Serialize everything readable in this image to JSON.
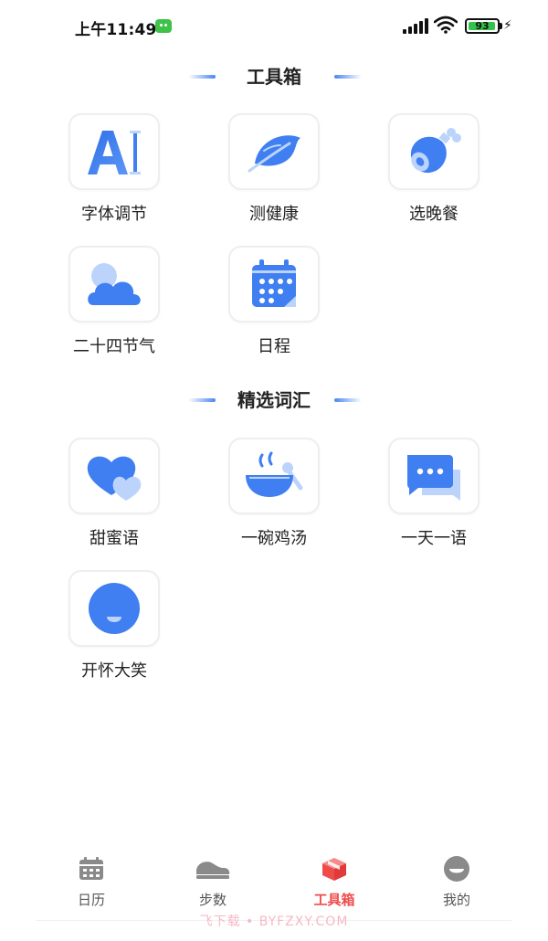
{
  "status_bar": {
    "time": "上午11:49",
    "battery": "93"
  },
  "sections": {
    "tools": {
      "title": "工具箱",
      "items": [
        {
          "label": "字体调节",
          "icon": "font-size-icon"
        },
        {
          "label": "测健康",
          "icon": "leaf-icon"
        },
        {
          "label": "选晚餐",
          "icon": "meat-drumstick-icon"
        },
        {
          "label": "二十四节气",
          "icon": "cloud-sun-icon"
        },
        {
          "label": "日程",
          "icon": "calendar-icon"
        }
      ]
    },
    "words": {
      "title": "精选词汇",
      "items": [
        {
          "label": "甜蜜语",
          "icon": "hearts-icon"
        },
        {
          "label": "一碗鸡汤",
          "icon": "soup-bowl-icon"
        },
        {
          "label": "一天一语",
          "icon": "chat-bubbles-icon"
        },
        {
          "label": "开怀大笑",
          "icon": "smile-face-icon"
        }
      ]
    }
  },
  "bottom_nav": {
    "items": [
      {
        "label": "日历",
        "icon": "calendar-nav-icon"
      },
      {
        "label": "步数",
        "icon": "shoe-icon"
      },
      {
        "label": "工具箱",
        "icon": "toolbox-icon",
        "active": true
      },
      {
        "label": "我的",
        "icon": "profile-face-icon"
      }
    ]
  },
  "watermark": "飞下载 • BYFZXY.COM",
  "colors": {
    "accent_blue": "#3f7ff1",
    "light_blue": "#bcd4fb",
    "active_red": "#f04b4b",
    "inactive_gray": "#8a8a8a"
  }
}
